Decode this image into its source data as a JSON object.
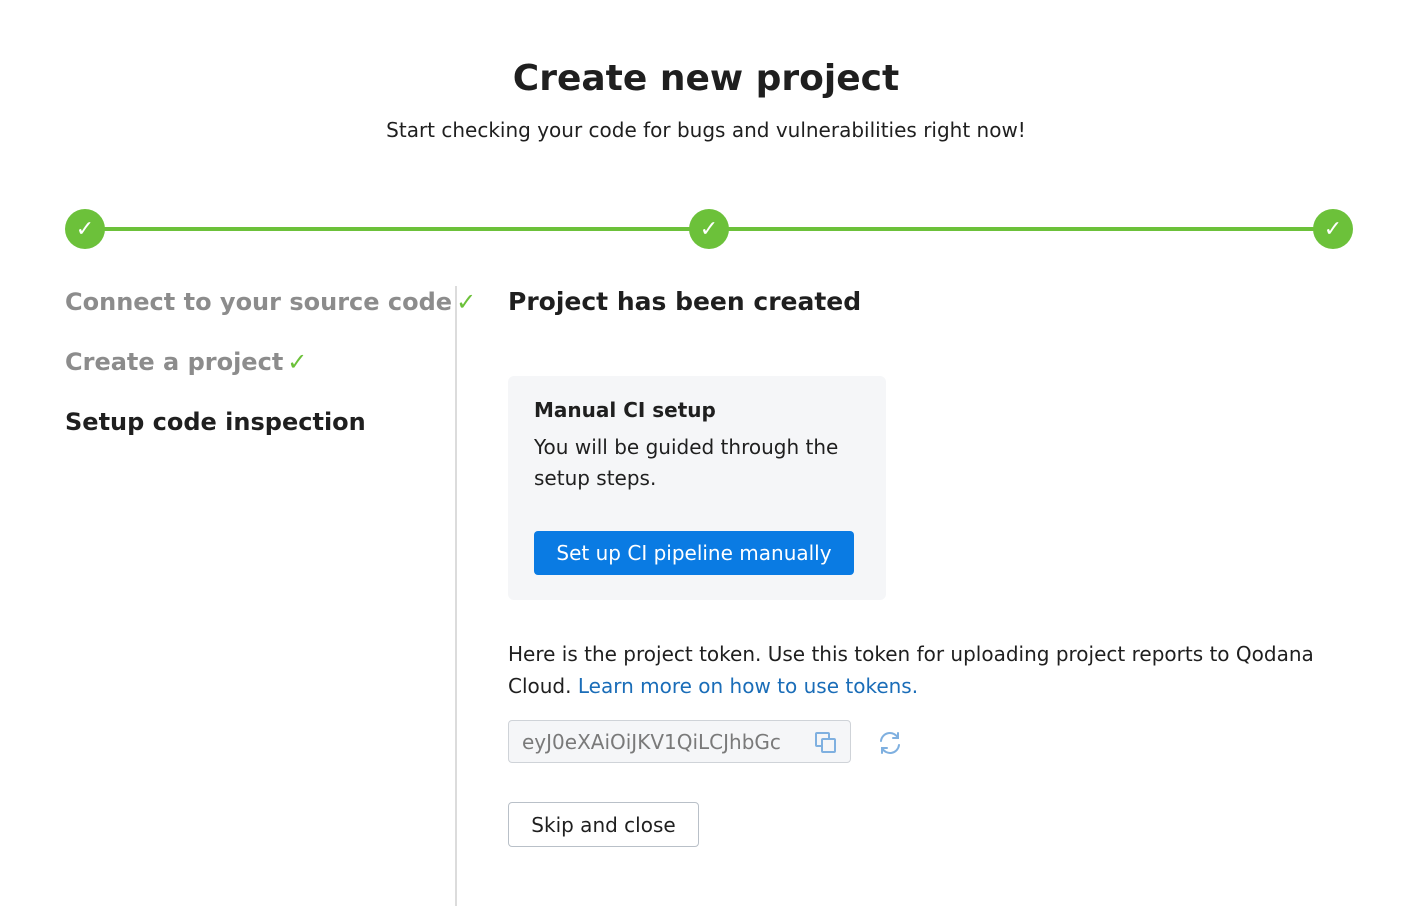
{
  "header": {
    "title": "Create new project",
    "subtitle": "Start checking your code for bugs and vulnerabilities right now!"
  },
  "progress": {
    "steps_completed": 3,
    "steps_total": 3,
    "check_glyph": "✓",
    "accent_color": "#6cc13a"
  },
  "steps": [
    {
      "label": "Connect to your source code",
      "status": "done",
      "check": "✓"
    },
    {
      "label": "Create a project",
      "status": "done",
      "check": "✓"
    },
    {
      "label": "Setup code inspection",
      "status": "active"
    }
  ],
  "main": {
    "title": "Project has been created",
    "ci_card": {
      "title": "Manual CI setup",
      "text": "You will be guided through the setup steps.",
      "button_label": "Set up CI pipeline manually"
    },
    "token_info": "Here is the project token. Use this token for uploading project reports to Qodana Cloud.",
    "token_link": "Learn more on how to use tokens.",
    "token_value": "eyJ0eXAiOiJKV1QiLCJhbGc",
    "copy_icon": "copy-icon",
    "refresh_icon": "refresh-icon",
    "skip_button": "Skip and close"
  },
  "colors": {
    "primary": "#0a7be3",
    "success": "#6cc13a",
    "link": "#1a6db8"
  }
}
